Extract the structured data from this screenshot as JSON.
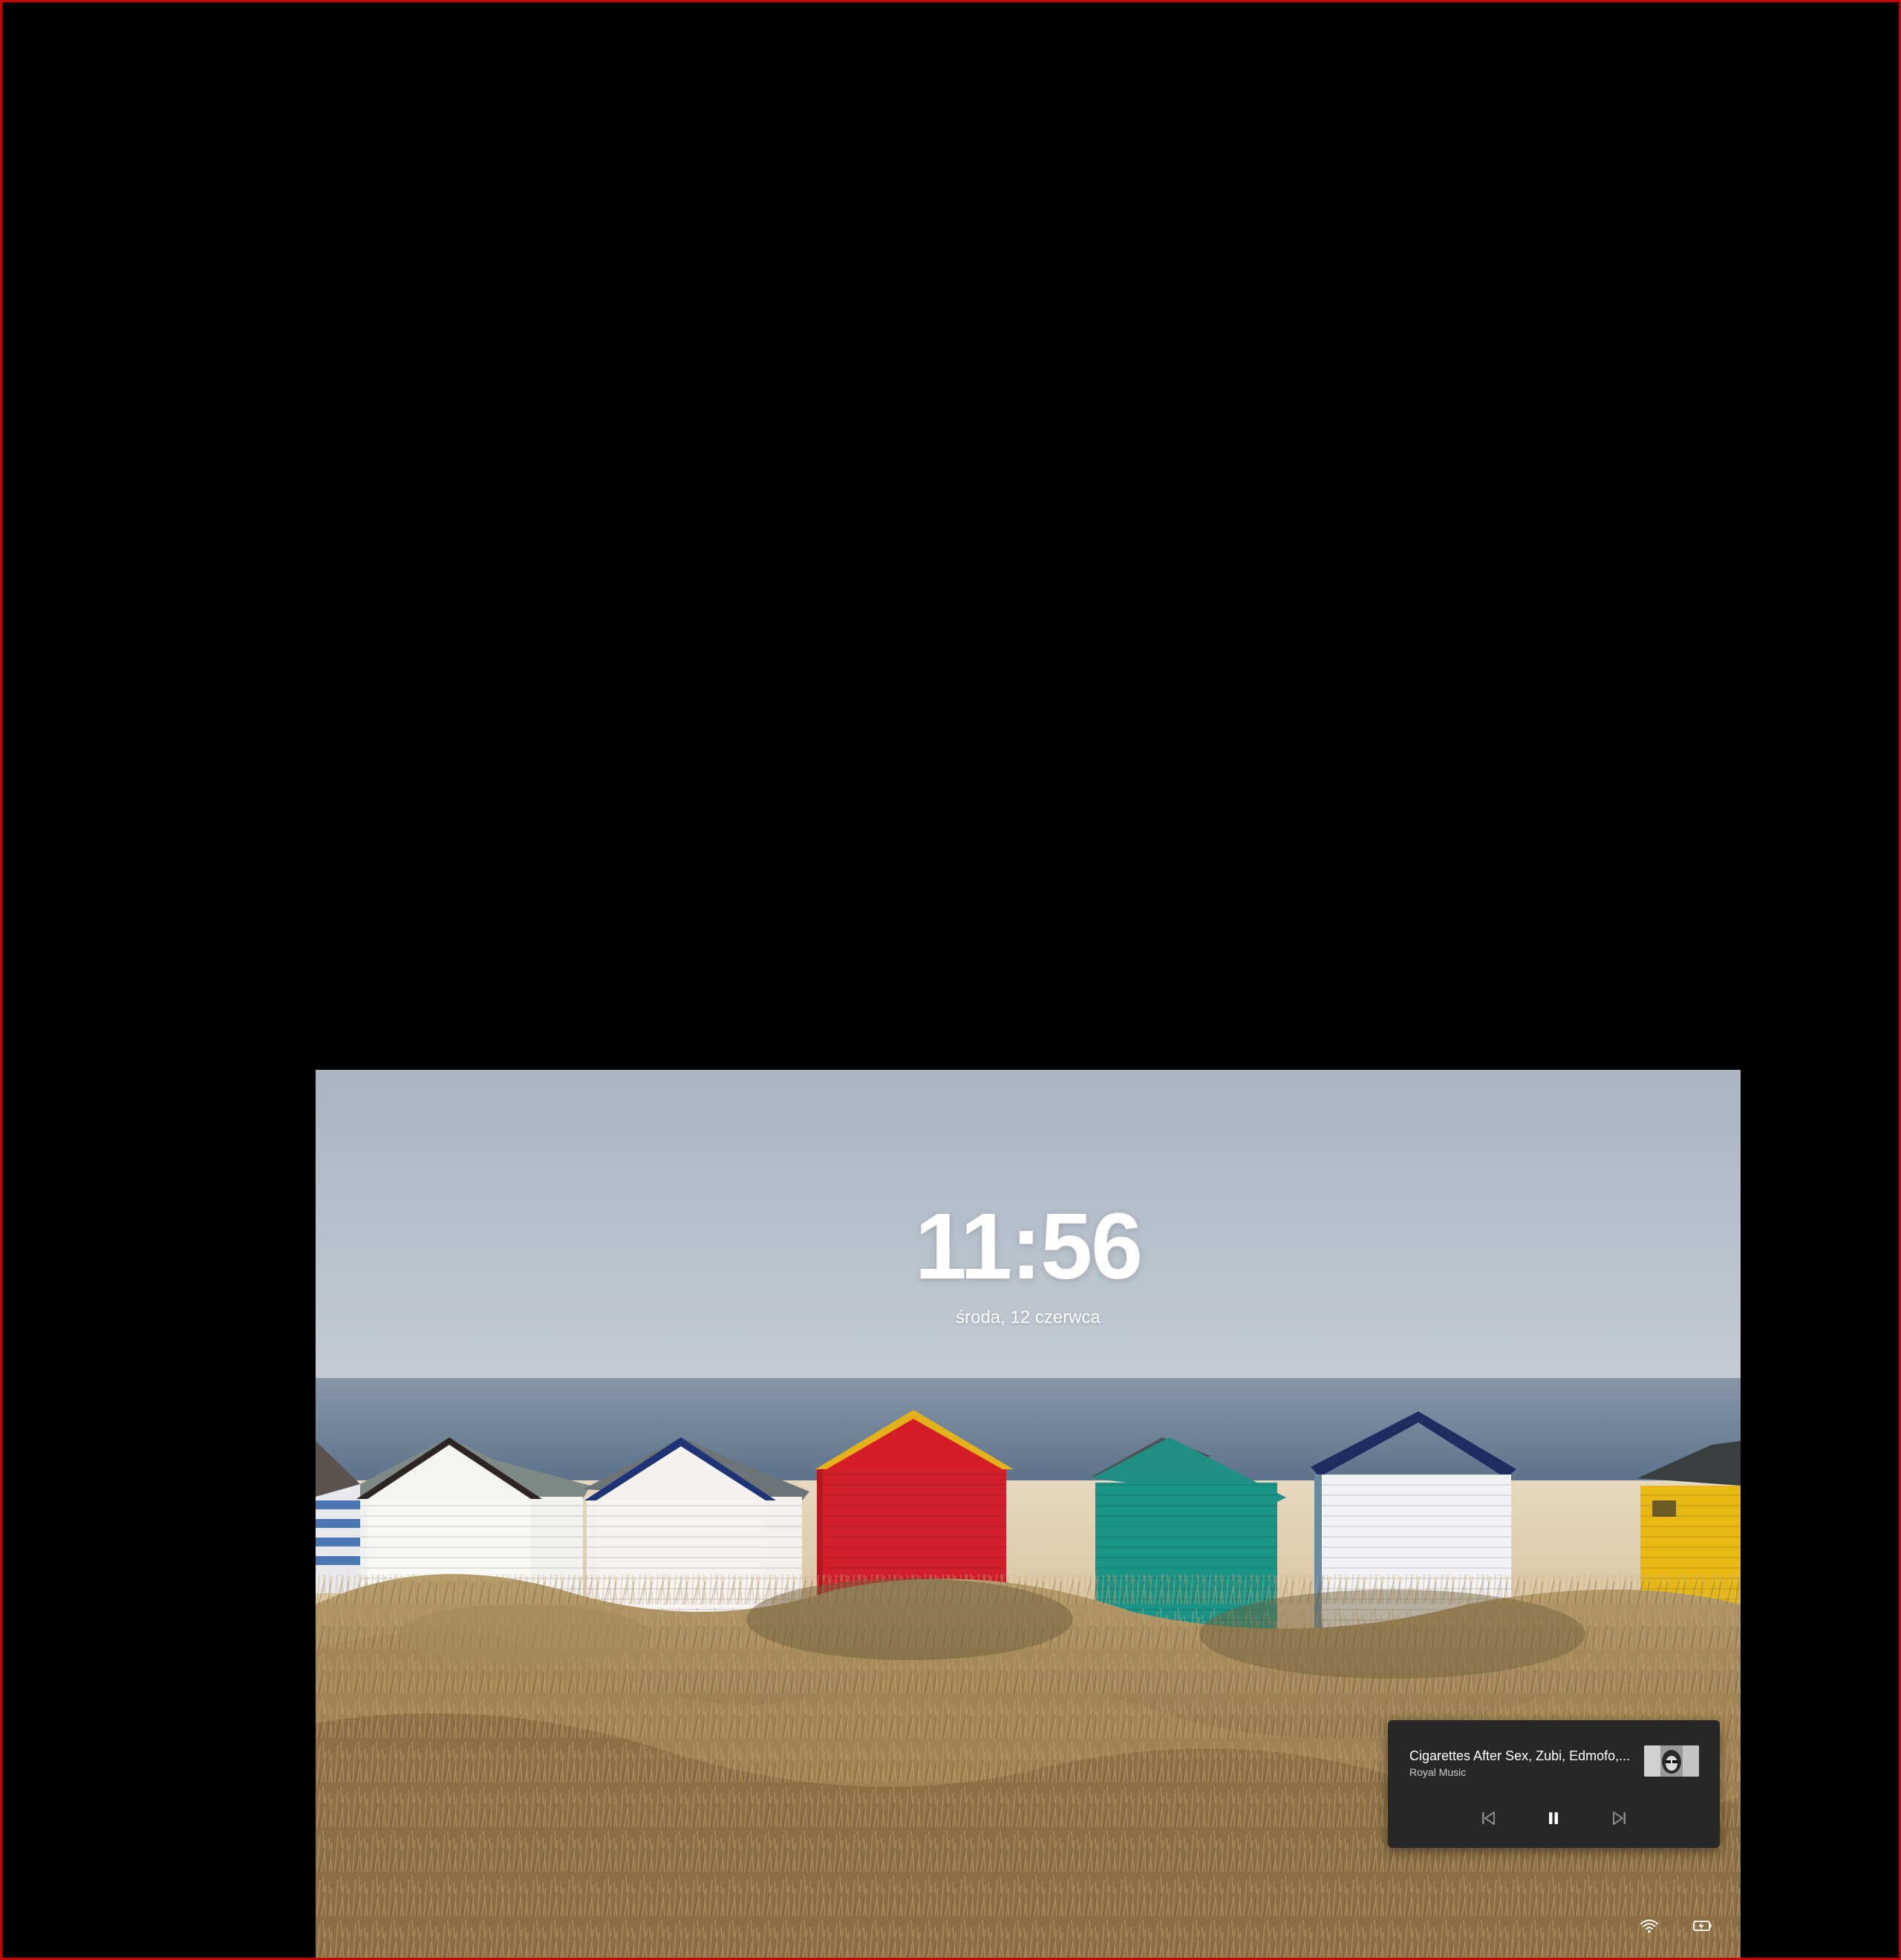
{
  "lock_screen": {
    "time": "11:56",
    "date": "środa, 12 czerwca"
  },
  "media": {
    "title": "Cigarettes After Sex, Zubi, Edmofo,...",
    "subtitle": "Royal Music",
    "controls": {
      "previous_icon": "previous-track-icon",
      "play_pause_icon": "pause-icon",
      "next_icon": "next-track-icon"
    }
  },
  "tray": {
    "wifi_icon": "wifi-icon",
    "battery_icon": "battery-charging-icon"
  },
  "colors": {
    "frame_border": "#c80000",
    "media_card_bg": "#272727"
  }
}
